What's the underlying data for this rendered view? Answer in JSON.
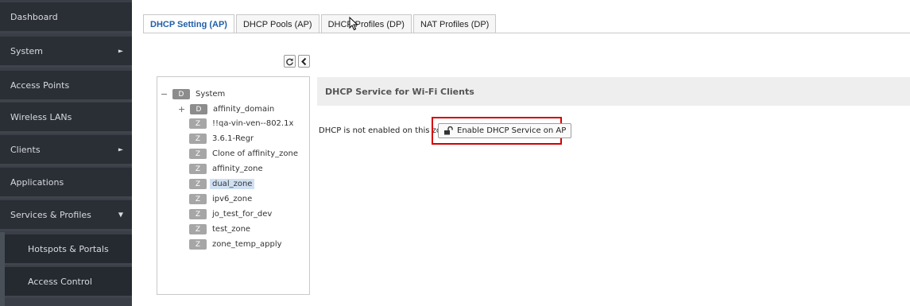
{
  "sidebar": {
    "items": [
      {
        "label": "Dashboard",
        "has_arrow": false
      },
      {
        "label": "System",
        "has_arrow": true,
        "arrow": "►"
      },
      {
        "label": "Access Points",
        "has_arrow": false
      },
      {
        "label": "Wireless LANs",
        "has_arrow": false
      },
      {
        "label": "Clients",
        "has_arrow": true,
        "arrow": "►"
      },
      {
        "label": "Applications",
        "has_arrow": false
      },
      {
        "label": "Services & Profiles",
        "has_arrow": true,
        "arrow": "▼"
      }
    ],
    "subitems": [
      {
        "label": "Hotspots & Portals"
      },
      {
        "label": "Access Control"
      }
    ]
  },
  "tabs": [
    {
      "label": "DHCP Setting (AP)",
      "active": true
    },
    {
      "label": "DHCP Pools (AP)",
      "active": false
    },
    {
      "label": "DHCP Profiles (DP)",
      "active": false
    },
    {
      "label": "NAT Profiles (DP)",
      "active": false
    }
  ],
  "toolbar": {
    "refresh_icon": "refresh-icon",
    "collapse_icon": "chevron-left-icon"
  },
  "tree": {
    "root": {
      "badge": "D",
      "label": "System",
      "toggle": "−"
    },
    "domain": {
      "badge": "D",
      "label": "affinity_domain",
      "toggle": "+"
    },
    "zones": [
      {
        "badge": "Z",
        "label": "!!qa-vin-ven--802.1x"
      },
      {
        "badge": "Z",
        "label": "3.6.1-Regr"
      },
      {
        "badge": "Z",
        "label": "Clone of affinity_zone"
      },
      {
        "badge": "Z",
        "label": "affinity_zone"
      },
      {
        "badge": "Z",
        "label": "dual_zone",
        "selected": true
      },
      {
        "badge": "Z",
        "label": "ipv6_zone"
      },
      {
        "badge": "Z",
        "label": "jo_test_for_dev"
      },
      {
        "badge": "Z",
        "label": "test_zone"
      },
      {
        "badge": "Z",
        "label": "zone_temp_apply"
      }
    ]
  },
  "content": {
    "header": "DHCP Service for Wi-Fi Clients",
    "status_text": "DHCP is not enabled on this zone.",
    "enable_button": "Enable DHCP Service on AP",
    "enable_icon": "unlock-icon"
  },
  "colors": {
    "sidebar_bg": "#2a2e35",
    "accent": "#1f5fa8",
    "highlight": "#d40000",
    "selected": "#cfe0f3"
  }
}
